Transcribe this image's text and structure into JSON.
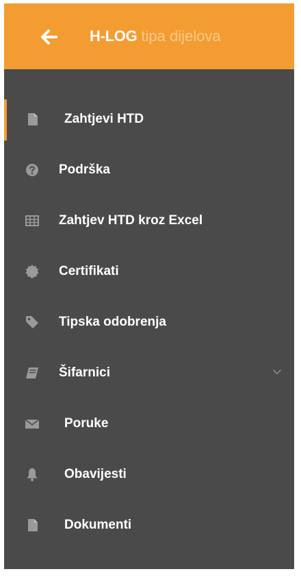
{
  "header": {
    "brand_strong": "H-LOG",
    "brand_light": "tipa dijelova",
    "back_icon": "arrow-left-icon",
    "color": "#f39c32"
  },
  "menu": {
    "active_index": 0,
    "accent_color": "#f39c32",
    "background_color": "#4a4a4a",
    "items": [
      {
        "label": "Zahtjevi HTD",
        "icon": "document-icon"
      },
      {
        "label": "Podrška",
        "icon": "question-circle-icon"
      },
      {
        "label": "Zahtjev HTD kroz Excel",
        "icon": "table-icon"
      },
      {
        "label": "Certifikati",
        "icon": "certificate-seal-icon"
      },
      {
        "label": "Tipska odobrenja",
        "icon": "tag-icon"
      },
      {
        "label": "Šifarnici",
        "icon": "book-icon",
        "expandable": true
      },
      {
        "label": "Poruke",
        "icon": "envelope-icon"
      },
      {
        "label": "Obavijesti",
        "icon": "bell-icon"
      },
      {
        "label": "Dokumenti",
        "icon": "document-icon"
      }
    ]
  }
}
